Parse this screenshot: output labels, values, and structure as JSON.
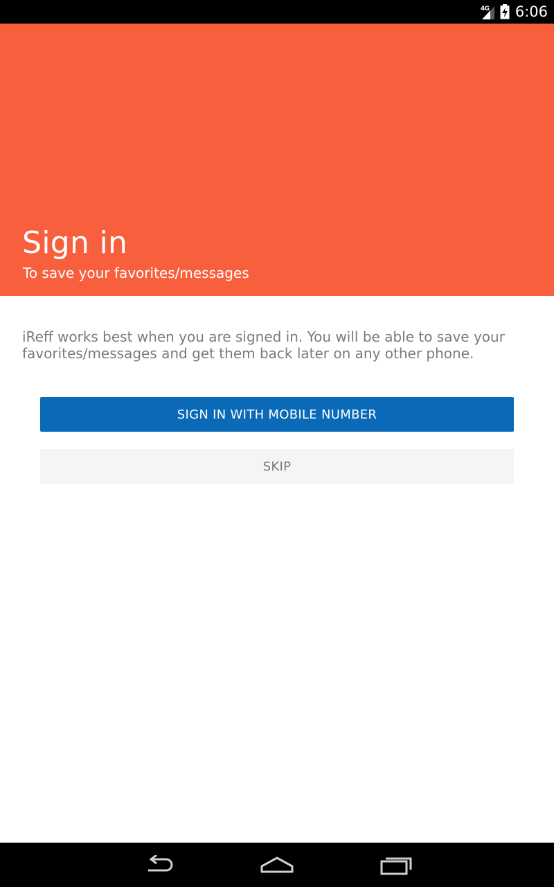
{
  "status_bar": {
    "network": "4G",
    "time": "6:06",
    "icons": [
      "signal-icon",
      "battery-icon"
    ]
  },
  "header": {
    "title": "Sign in",
    "subtitle": "To save your favorites/messages",
    "background_color": "#f85f3d"
  },
  "content": {
    "intro": "iReff works best when you are signed in. You will be able to save your favorites/messages and get them back later on any other phone."
  },
  "buttons": {
    "primary_label": "SIGN IN WITH MOBILE NUMBER",
    "primary_color": "#0a6ab7",
    "skip_label": "SKIP"
  },
  "nav_bar": {
    "icons": [
      "back-icon",
      "home-icon",
      "recent-apps-icon"
    ]
  }
}
